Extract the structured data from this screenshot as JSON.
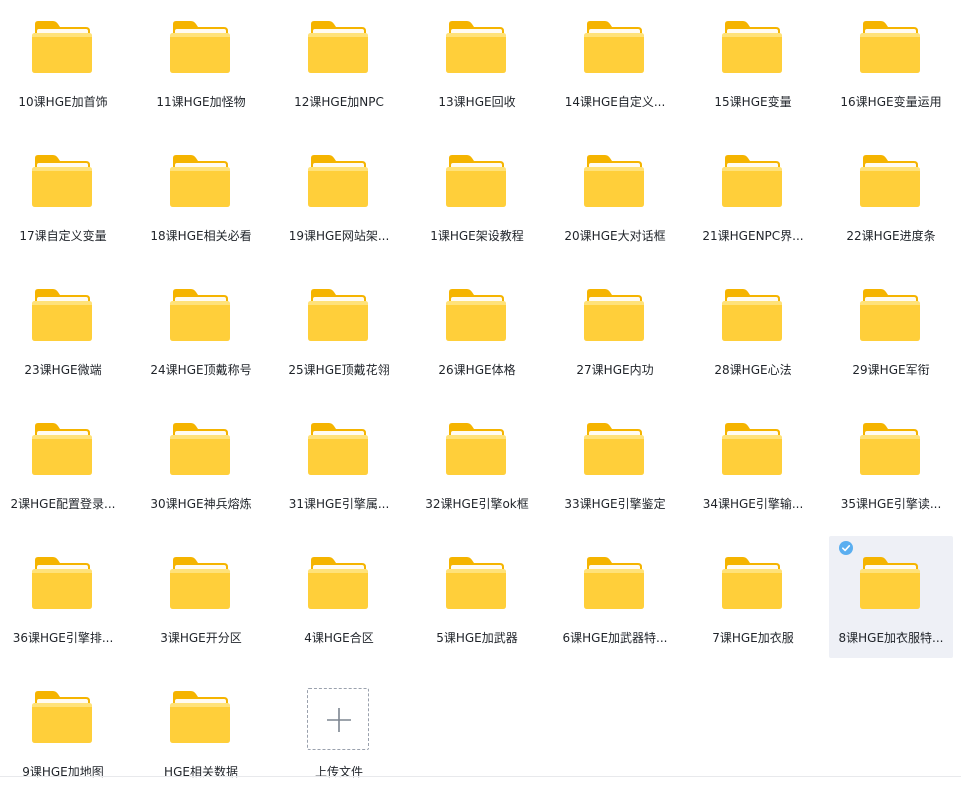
{
  "colors": {
    "folder_back": "#F5B400",
    "folder_front": "#FFCF3A",
    "folder_highlight": "#FFE27A",
    "selected_bg": "#eef0f6",
    "check_blue": "#5AAEF0"
  },
  "files": [
    {
      "name": "10课HGE加首饰"
    },
    {
      "name": "11课HGE加怪物"
    },
    {
      "name": "12课HGE加NPC"
    },
    {
      "name": "13课HGE回收"
    },
    {
      "name": "14课HGE自定义..."
    },
    {
      "name": "15课HGE变量"
    },
    {
      "name": "16课HGE变量运用"
    },
    {
      "name": "17课自定义变量"
    },
    {
      "name": "18课HGE相关必看"
    },
    {
      "name": "19课HGE网站架..."
    },
    {
      "name": "1课HGE架设教程"
    },
    {
      "name": "20课HGE大对话框"
    },
    {
      "name": "21课HGENPC界..."
    },
    {
      "name": "22课HGE进度条"
    },
    {
      "name": "23课HGE微端"
    },
    {
      "name": "24课HGE顶戴称号"
    },
    {
      "name": "25课HGE顶戴花翎"
    },
    {
      "name": "26课HGE体格"
    },
    {
      "name": "27课HGE内功"
    },
    {
      "name": "28课HGE心法"
    },
    {
      "name": "29课HGE军衔"
    },
    {
      "name": "2课HGE配置登录..."
    },
    {
      "name": "30课HGE神兵熔炼"
    },
    {
      "name": "31课HGE引擎属..."
    },
    {
      "name": "32课HGE引擎ok框"
    },
    {
      "name": "33课HGE引擎鉴定"
    },
    {
      "name": "34课HGE引擎输..."
    },
    {
      "name": "35课HGE引擎读..."
    },
    {
      "name": "36课HGE引擎排..."
    },
    {
      "name": "3课HGE开分区"
    },
    {
      "name": "4课HGE合区"
    },
    {
      "name": "5课HGE加武器"
    },
    {
      "name": "6课HGE加武器特..."
    },
    {
      "name": "7课HGE加衣服"
    },
    {
      "name": "8课HGE加衣服特...",
      "selected": true
    },
    {
      "name": "9课HGE加地图"
    },
    {
      "name": "HGE相关数据"
    }
  ],
  "upload": {
    "label": "上传文件",
    "icon": "plus-icon"
  }
}
